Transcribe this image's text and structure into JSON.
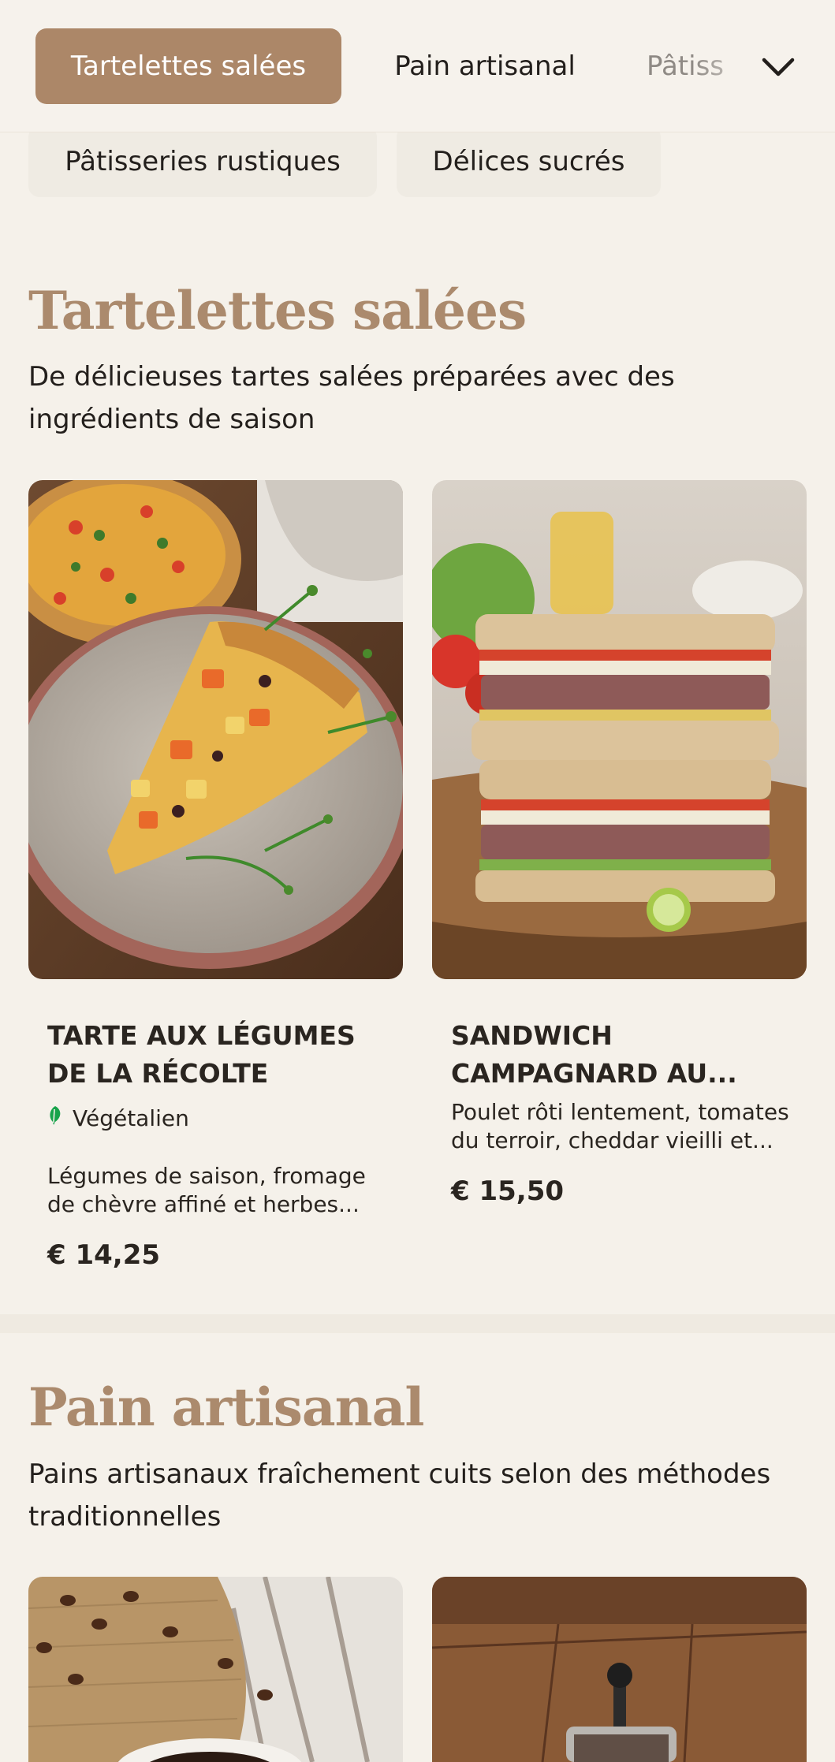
{
  "nav": {
    "tabs": [
      {
        "label": "Tartelettes salées",
        "active": true
      },
      {
        "label": "Pain artisanal",
        "active": false
      },
      {
        "label": "Pâtisseries rustiques",
        "active": false
      }
    ],
    "partial_label": "Pâtiss",
    "expand_icon": "chevron-down-icon",
    "pills": [
      "Pâtisseries rustiques",
      "Délices sucrés"
    ]
  },
  "sections": [
    {
      "title": "Tartelettes salées",
      "description": "De délicieuses tartes salées préparées avec des ingrédients de saison",
      "products": [
        {
          "name": "TARTE AUX LÉGUMES DE LA RÉCOLTE",
          "badge": "Végétalien",
          "badge_icon": "leaf-icon",
          "description": "Légumes de saison, fromage de chèvre affiné et herbes...",
          "price": "€ 14,25"
        },
        {
          "name": "SANDWICH CAMPAGNARD AU...",
          "description": "Poulet rôti lentement, tomates du terroir, cheddar vieilli et...",
          "price": "€ 15,50"
        }
      ]
    },
    {
      "title": "Pain artisanal",
      "description": "Pains artisanaux fraîchement cuits selon des méthodes traditionnelles"
    }
  ],
  "colors": {
    "accent": "#ac8768",
    "title": "#ab8a6d",
    "background": "#f5f1ea",
    "badge_green": "#17a34a"
  }
}
